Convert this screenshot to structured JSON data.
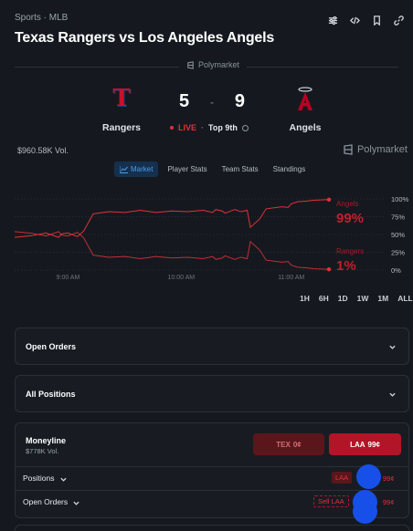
{
  "header": {
    "breadcrumb": "Sports · MLB",
    "title": "Texas Rangers vs Los Angeles Angels",
    "toolbar_icons": [
      "sliders-icon",
      "code-icon",
      "bookmark-icon",
      "link-icon"
    ]
  },
  "source": {
    "label": "Polymarket"
  },
  "game": {
    "home": {
      "name": "Rangers",
      "abbr": "T",
      "color": "#c8102e"
    },
    "away": {
      "name": "Angels",
      "color": "#ba0021"
    },
    "home_score": "5",
    "away_score": "9",
    "score_sep": "-",
    "status": "LIVE",
    "status_sep": "·",
    "inning": "Top 9th"
  },
  "market": {
    "volume": "$960.58K Vol.",
    "brand": "Polymarket"
  },
  "tabs": [
    {
      "label": "Market",
      "active": true
    },
    {
      "label": "Player Stats",
      "active": false
    },
    {
      "label": "Team Stats",
      "active": false
    },
    {
      "label": "Standings",
      "active": false
    }
  ],
  "chart_data": {
    "type": "line",
    "x_ticks": [
      "9:00 AM",
      "10:00 AM",
      "11:00 AM"
    ],
    "y_ticks": [
      "100%",
      "75%",
      "50%",
      "25%",
      "0%"
    ],
    "ylim": [
      0,
      100
    ],
    "series": [
      {
        "name": "Angels",
        "current": "99%",
        "color": "#e0313c",
        "x": [
          0,
          5,
          10,
          14,
          15,
          17,
          20,
          22,
          25,
          30,
          35,
          40,
          45,
          50,
          55,
          60,
          63,
          64,
          66,
          67,
          70,
          72,
          74,
          75,
          78,
          80,
          85,
          87,
          88,
          90,
          93,
          95,
          100
        ],
        "values": [
          46,
          48,
          52,
          46,
          51,
          52,
          47,
          55,
          79,
          82,
          81,
          84,
          81,
          83,
          82,
          84,
          81,
          85,
          83,
          80,
          85,
          82,
          84,
          60,
          72,
          86,
          89,
          88,
          93,
          96,
          97,
          98,
          99
        ]
      },
      {
        "name": "Rangers",
        "current": "1%",
        "color": "#e0313c",
        "x": [
          0,
          5,
          10,
          14,
          15,
          17,
          20,
          22,
          25,
          30,
          35,
          40,
          45,
          50,
          55,
          60,
          63,
          64,
          66,
          67,
          70,
          72,
          74,
          75,
          78,
          80,
          85,
          87,
          88,
          90,
          93,
          95,
          100
        ],
        "values": [
          54,
          52,
          48,
          54,
          49,
          48,
          53,
          45,
          21,
          18,
          19,
          16,
          19,
          17,
          18,
          16,
          19,
          15,
          17,
          20,
          15,
          18,
          16,
          40,
          28,
          14,
          11,
          12,
          7,
          4,
          3,
          2,
          1
        ]
      }
    ]
  },
  "timeframes": [
    "1H",
    "6H",
    "1D",
    "1W",
    "1M",
    "ALL"
  ],
  "panels": {
    "open_orders": "Open Orders",
    "all_positions": "All Positions"
  },
  "moneyline": {
    "title": "Moneyline",
    "volume": "$778K Vol.",
    "tex_label": "TEX",
    "tex_price": "0¢",
    "laa_label": "LAA",
    "laa_price": "99¢",
    "positions_label": "Positions",
    "positions_tag": "LAA",
    "positions_price": "99¢",
    "orders_label": "Open Orders",
    "orders_tag": "Sell LAA",
    "orders_price": "99¢"
  }
}
